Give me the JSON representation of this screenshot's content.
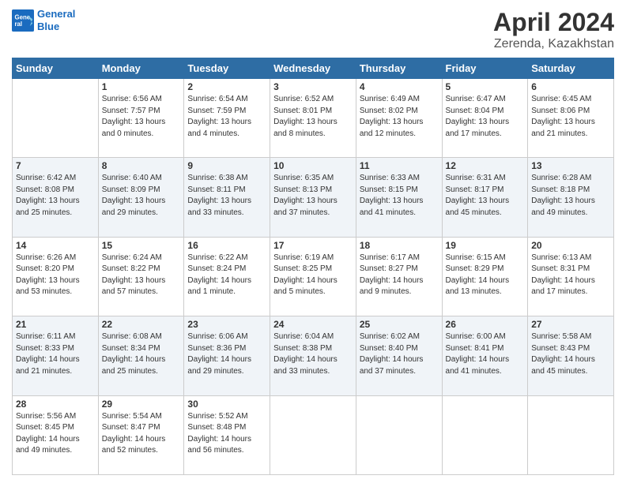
{
  "logo": {
    "line1": "General",
    "line2": "Blue"
  },
  "title": "April 2024",
  "location": "Zerenda, Kazakhstan",
  "days_of_week": [
    "Sunday",
    "Monday",
    "Tuesday",
    "Wednesday",
    "Thursday",
    "Friday",
    "Saturday"
  ],
  "weeks": [
    [
      {
        "num": "",
        "empty": true
      },
      {
        "num": "1",
        "sunrise": "6:56 AM",
        "sunset": "7:57 PM",
        "daylight": "13 hours and 0 minutes."
      },
      {
        "num": "2",
        "sunrise": "6:54 AM",
        "sunset": "7:59 PM",
        "daylight": "13 hours and 4 minutes."
      },
      {
        "num": "3",
        "sunrise": "6:52 AM",
        "sunset": "8:01 PM",
        "daylight": "13 hours and 8 minutes."
      },
      {
        "num": "4",
        "sunrise": "6:49 AM",
        "sunset": "8:02 PM",
        "daylight": "13 hours and 12 minutes."
      },
      {
        "num": "5",
        "sunrise": "6:47 AM",
        "sunset": "8:04 PM",
        "daylight": "13 hours and 17 minutes."
      },
      {
        "num": "6",
        "sunrise": "6:45 AM",
        "sunset": "8:06 PM",
        "daylight": "13 hours and 21 minutes."
      }
    ],
    [
      {
        "num": "7",
        "sunrise": "6:42 AM",
        "sunset": "8:08 PM",
        "daylight": "13 hours and 25 minutes."
      },
      {
        "num": "8",
        "sunrise": "6:40 AM",
        "sunset": "8:09 PM",
        "daylight": "13 hours and 29 minutes."
      },
      {
        "num": "9",
        "sunrise": "6:38 AM",
        "sunset": "8:11 PM",
        "daylight": "13 hours and 33 minutes."
      },
      {
        "num": "10",
        "sunrise": "6:35 AM",
        "sunset": "8:13 PM",
        "daylight": "13 hours and 37 minutes."
      },
      {
        "num": "11",
        "sunrise": "6:33 AM",
        "sunset": "8:15 PM",
        "daylight": "13 hours and 41 minutes."
      },
      {
        "num": "12",
        "sunrise": "6:31 AM",
        "sunset": "8:17 PM",
        "daylight": "13 hours and 45 minutes."
      },
      {
        "num": "13",
        "sunrise": "6:28 AM",
        "sunset": "8:18 PM",
        "daylight": "13 hours and 49 minutes."
      }
    ],
    [
      {
        "num": "14",
        "sunrise": "6:26 AM",
        "sunset": "8:20 PM",
        "daylight": "13 hours and 53 minutes."
      },
      {
        "num": "15",
        "sunrise": "6:24 AM",
        "sunset": "8:22 PM",
        "daylight": "13 hours and 57 minutes."
      },
      {
        "num": "16",
        "sunrise": "6:22 AM",
        "sunset": "8:24 PM",
        "daylight": "14 hours and 1 minute."
      },
      {
        "num": "17",
        "sunrise": "6:19 AM",
        "sunset": "8:25 PM",
        "daylight": "14 hours and 5 minutes."
      },
      {
        "num": "18",
        "sunrise": "6:17 AM",
        "sunset": "8:27 PM",
        "daylight": "14 hours and 9 minutes."
      },
      {
        "num": "19",
        "sunrise": "6:15 AM",
        "sunset": "8:29 PM",
        "daylight": "14 hours and 13 minutes."
      },
      {
        "num": "20",
        "sunrise": "6:13 AM",
        "sunset": "8:31 PM",
        "daylight": "14 hours and 17 minutes."
      }
    ],
    [
      {
        "num": "21",
        "sunrise": "6:11 AM",
        "sunset": "8:33 PM",
        "daylight": "14 hours and 21 minutes."
      },
      {
        "num": "22",
        "sunrise": "6:08 AM",
        "sunset": "8:34 PM",
        "daylight": "14 hours and 25 minutes."
      },
      {
        "num": "23",
        "sunrise": "6:06 AM",
        "sunset": "8:36 PM",
        "daylight": "14 hours and 29 minutes."
      },
      {
        "num": "24",
        "sunrise": "6:04 AM",
        "sunset": "8:38 PM",
        "daylight": "14 hours and 33 minutes."
      },
      {
        "num": "25",
        "sunrise": "6:02 AM",
        "sunset": "8:40 PM",
        "daylight": "14 hours and 37 minutes."
      },
      {
        "num": "26",
        "sunrise": "6:00 AM",
        "sunset": "8:41 PM",
        "daylight": "14 hours and 41 minutes."
      },
      {
        "num": "27",
        "sunrise": "5:58 AM",
        "sunset": "8:43 PM",
        "daylight": "14 hours and 45 minutes."
      }
    ],
    [
      {
        "num": "28",
        "sunrise": "5:56 AM",
        "sunset": "8:45 PM",
        "daylight": "14 hours and 49 minutes."
      },
      {
        "num": "29",
        "sunrise": "5:54 AM",
        "sunset": "8:47 PM",
        "daylight": "14 hours and 52 minutes."
      },
      {
        "num": "30",
        "sunrise": "5:52 AM",
        "sunset": "8:48 PM",
        "daylight": "14 hours and 56 minutes."
      },
      {
        "num": "",
        "empty": true
      },
      {
        "num": "",
        "empty": true
      },
      {
        "num": "",
        "empty": true
      },
      {
        "num": "",
        "empty": true
      }
    ]
  ],
  "labels": {
    "sunrise": "Sunrise:",
    "sunset": "Sunset:",
    "daylight": "Daylight:"
  }
}
